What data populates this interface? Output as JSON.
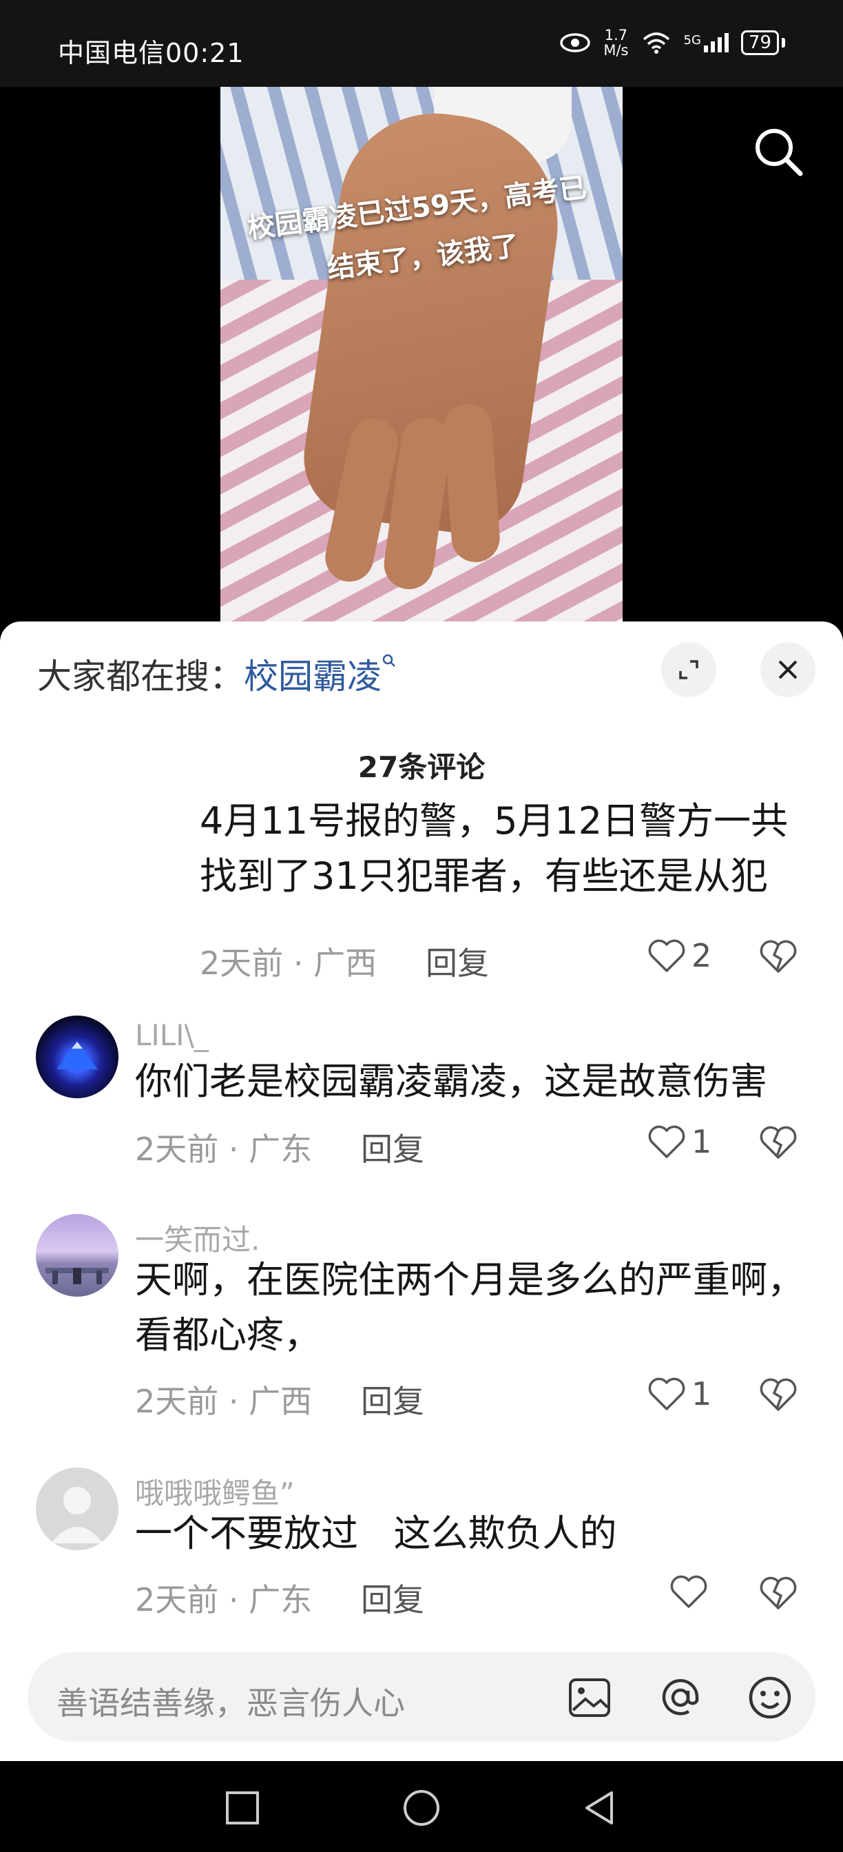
{
  "status": {
    "carrier_time": "中国电信00:21",
    "speed_value": "1.7",
    "speed_unit": "M/s",
    "network": "5G",
    "battery": "79"
  },
  "video": {
    "overlay_text": "校园霸凌已过59天，高考已结束了，该我了"
  },
  "search_hint": {
    "prefix": "大家都在搜：",
    "keyword": "校园霸凌"
  },
  "comments_count": "27条评论",
  "comments": [
    {
      "username": "",
      "text": "4月11号报的警，5月12日警方一共找到了31只犯罪者，有些还是从犯",
      "meta": "2天前 · 广西",
      "reply": "回复",
      "likes": "2"
    },
    {
      "username": "LILI\\_",
      "text": "你们老是校园霸凌霸凌，这是故意伤害",
      "meta": "2天前 · 广东",
      "reply": "回复",
      "likes": "1"
    },
    {
      "username": "一笑而过.",
      "text": "天啊，在医院住两个月是多么的严重啊，看都心疼，",
      "meta": "2天前 · 广西",
      "reply": "回复",
      "likes": "1"
    },
    {
      "username": "哦哦哦鳄鱼”",
      "text": "一个不要放过   这么欺负人的",
      "meta": "2天前 · 广东",
      "reply": "回复",
      "likes": ""
    }
  ],
  "input": {
    "placeholder": "善语结善缘，恶言伤人心"
  },
  "icons": {
    "search": "search-icon",
    "expand": "expand-icon",
    "close": "close-icon",
    "like": "heart-icon",
    "dislike": "broken-heart-icon",
    "image": "image-icon",
    "mention": "at-icon",
    "emoji": "emoji-icon"
  },
  "colors": {
    "keyword": "#2f5a9e",
    "username": "#a8a8a8",
    "sheet_bg": "#ffffff"
  }
}
